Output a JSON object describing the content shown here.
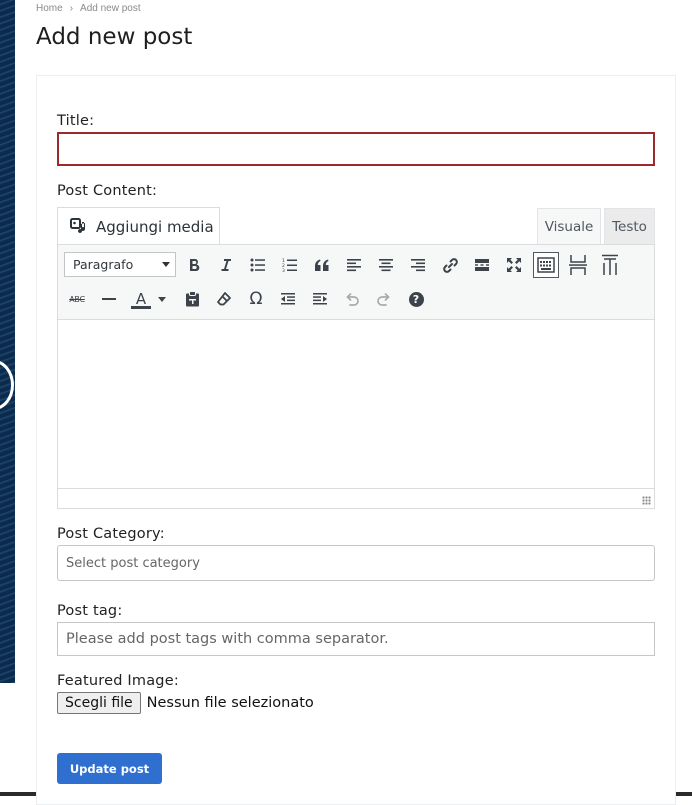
{
  "breadcrumb": {
    "home": "Home",
    "separator": "›",
    "current": "Add new post"
  },
  "page_title": "Add new post",
  "form": {
    "title_label": "Title:",
    "title_value": "",
    "content_label": "Post Content:",
    "category_label": "Post Category:",
    "category_placeholder": "Select post category",
    "tag_label": "Post tag:",
    "tag_placeholder": "Please add post tags with comma separator.",
    "image_label": "Featured Image:",
    "file_button": "Scegli file",
    "file_status": "Nessun file selezionato",
    "submit_label": "Update post"
  },
  "editor": {
    "media_button": "Aggiungi media",
    "tab_visual": "Visuale",
    "tab_text": "Testo",
    "format_select": "Paragrafo",
    "toolbar_row1": [
      "bold-icon",
      "italic-icon",
      "bullet-list-icon",
      "numbered-list-icon",
      "blockquote-icon",
      "align-left-icon",
      "align-center-icon",
      "align-right-icon",
      "link-icon",
      "read-more-icon",
      "fullscreen-icon",
      "toolbar-toggle-icon",
      "page-break-icon",
      "embed-icon"
    ],
    "toolbar_row2": [
      "strikethrough-icon",
      "horizontal-line-icon",
      "text-color-icon",
      "paste-text-icon",
      "clear-format-icon",
      "special-char-icon",
      "outdent-icon",
      "indent-icon",
      "undo-icon",
      "redo-icon",
      "help-icon"
    ],
    "strike_label": "ABC",
    "text_color_label": "A",
    "omega_label": "Ω",
    "help_label": "?"
  },
  "colors": {
    "title_border": "#9b2a2a",
    "submit_bg": "#2f6fcf",
    "toolbar_bg": "#f6f7f7"
  }
}
